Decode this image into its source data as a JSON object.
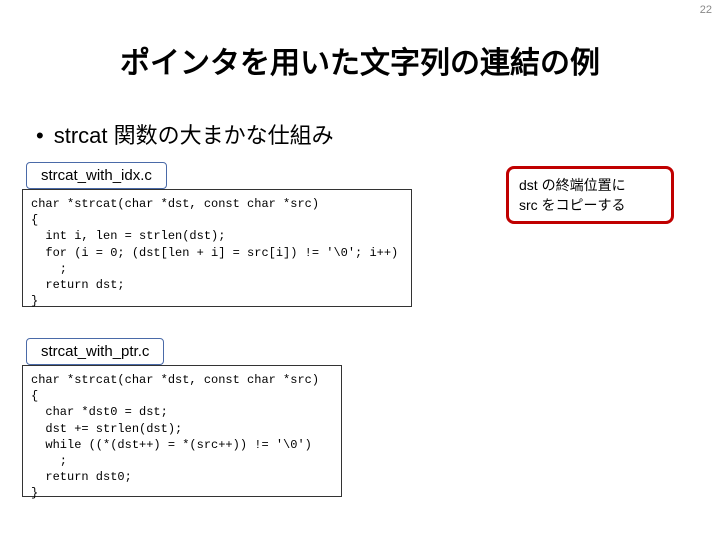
{
  "page_number": "22",
  "title": "ポインタを用いた文字列の連結の例",
  "bullet": "strcat 関数の大まかな仕組み",
  "file1_label": "strcat_with_idx.c",
  "code1": "char *strcat(char *dst, const char *src)\n{\n  int i, len = strlen(dst);\n  for (i = 0; (dst[len + i] = src[i]) != '\\0'; i++)\n    ;\n  return dst;\n}",
  "file2_label": "strcat_with_ptr.c",
  "code2": "char *strcat(char *dst, const char *src)\n{\n  char *dst0 = dst;\n  dst += strlen(dst);\n  while ((*(dst++) = *(src++)) != '\\0')\n    ;\n  return dst0;\n}",
  "callout_line1": "dst の終端位置に",
  "callout_line2": "src をコピーする"
}
